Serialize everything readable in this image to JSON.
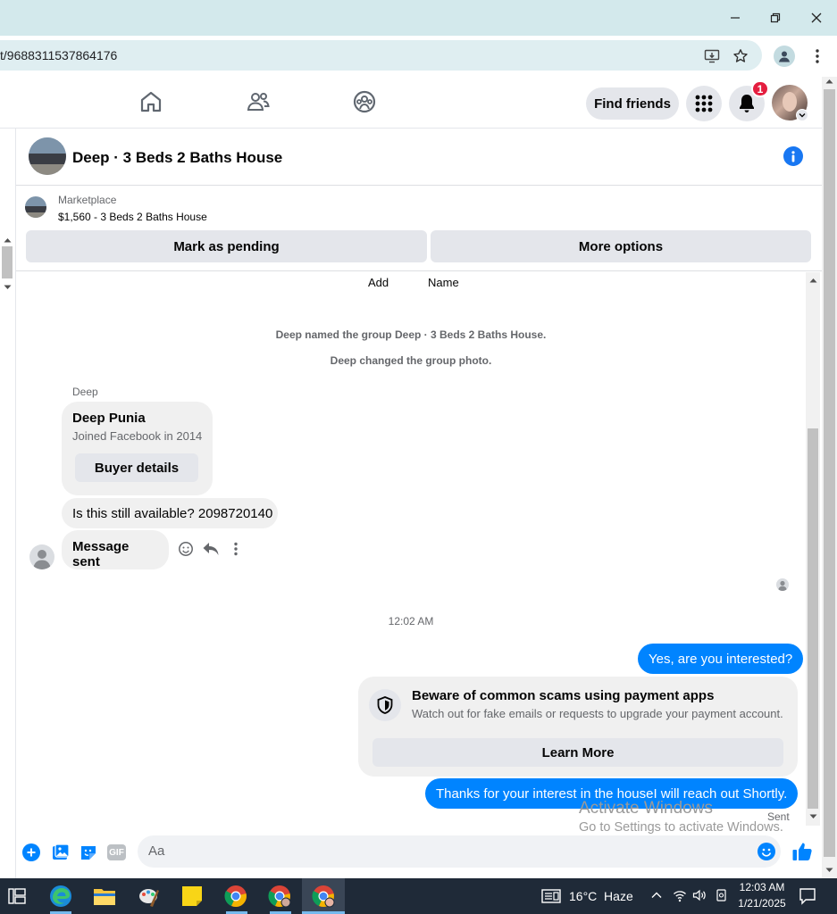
{
  "browser": {
    "url": "t/9688311537864176",
    "window_controls": [
      "minimize-icon",
      "restore-icon",
      "close-icon"
    ]
  },
  "fb_nav": {
    "find_friends": "Find friends",
    "notification_count": "1"
  },
  "chat": {
    "title": "Deep · 3 Beds 2 Baths House",
    "marketplace_label": "Marketplace",
    "listing": "$1,560 - 3 Beds 2 Baths House",
    "mark_pending": "Mark as pending",
    "more_options": "More options"
  },
  "messages": {
    "header_add": "Add",
    "header_name": "Name",
    "sys1": "Deep named the group Deep · 3 Beds 2 Baths House.",
    "sys2": "Deep changed the group photo.",
    "sender": "Deep",
    "card_name": "Deep Punia",
    "card_sub": "Joined Facebook in 2014",
    "card_button": "Buyer details",
    "msg1": "Is this still available? 2098720140",
    "msg2": "Message sent",
    "timestamp": "12:02 AM",
    "my_msg1": "Yes, are you interested?",
    "scam_title": "Beware of common scams using payment apps",
    "scam_sub": "Watch out for fake emails or requests to upgrade your payment account.",
    "learn_more": "Learn More",
    "my_msg2": "Thanks for your interest in the houseI will reach out Shortly.",
    "sent_status": "Sent"
  },
  "composer": {
    "placeholder": "Aa",
    "gif_label": "GIF"
  },
  "watermark": {
    "line1": "Activate Windows",
    "line2": "Go to Settings to activate Windows."
  },
  "taskbar": {
    "weather": "16°C  Haze",
    "time": "12:03 AM",
    "date": "1/21/2025"
  },
  "colors": {
    "messenger_blue": "#0084ff",
    "fb_blue": "#1877f2",
    "notif_red": "#e41e3f",
    "taskbar": "#1f2a38"
  }
}
